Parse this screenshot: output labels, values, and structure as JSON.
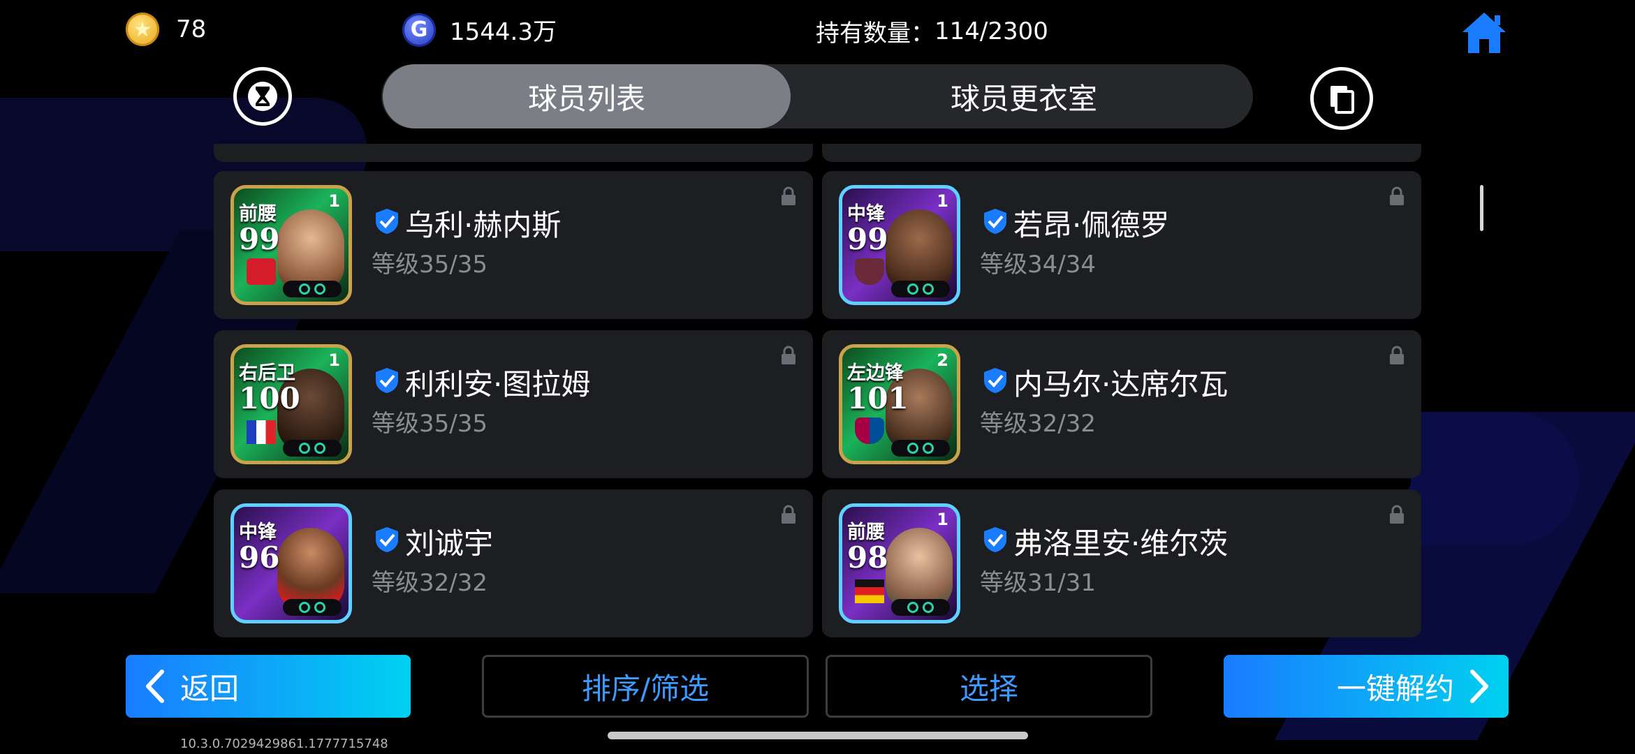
{
  "topbar": {
    "coins": "78",
    "gp": "1544.3万",
    "holdings_label": "持有数量：",
    "holdings_value": "114/2300",
    "coin_icon": "star-coin-icon",
    "gp_icon": "gp-currency-icon",
    "home_icon": "home-icon"
  },
  "tabs": [
    {
      "label": "球员列表",
      "active": true
    },
    {
      "label": "球员更衣室",
      "active": false
    }
  ],
  "players": [
    {
      "name": "乌利·赫内斯",
      "level": "等级35/35",
      "position": "前腰",
      "rating": "99",
      "card_level": "1",
      "frame": "green"
    },
    {
      "name": "若昂·佩德罗",
      "level": "等级34/34",
      "position": "中锋",
      "rating": "99",
      "card_level": "1",
      "frame": "purple"
    },
    {
      "name": "利利安·图拉姆",
      "level": "等级35/35",
      "position": "右后卫",
      "rating": "100",
      "card_level": "1",
      "frame": "green"
    },
    {
      "name": "内马尔·达席尔瓦",
      "level": "等级32/32",
      "position": "左边锋",
      "rating": "101",
      "card_level": "2",
      "frame": "green"
    },
    {
      "name": "刘诚宇",
      "level": "等级32/32",
      "position": "中锋",
      "rating": "96",
      "card_level": "",
      "frame": "purple"
    },
    {
      "name": "弗洛里安·维尔茨",
      "level": "等级31/31",
      "position": "前腰",
      "rating": "98",
      "card_level": "1",
      "frame": "purple"
    }
  ],
  "buttons": {
    "back": "返回",
    "sort_filter": "排序/筛选",
    "select": "选择",
    "release_all": "一键解约"
  },
  "version": "10.3.0.7029429861.1777715748",
  "colors": {
    "accent_blue": "#1a7cff",
    "accent_cyan": "#00d1f0",
    "link_blue": "#3d9bff",
    "card_bg": "#1d1e22",
    "frame_green": "#c9a24a",
    "frame_purple": "#5fd0ff"
  }
}
